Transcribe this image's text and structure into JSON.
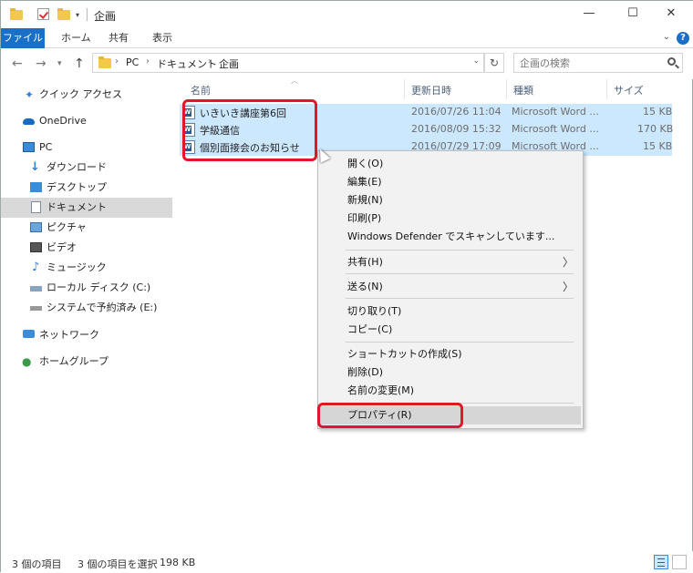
{
  "window": {
    "title": "企画",
    "controls": {
      "minimize": "—",
      "maximize": "☐",
      "close": "✕"
    }
  },
  "ribbon": {
    "tabs": [
      "ファイル",
      "ホーム",
      "共有",
      "表示"
    ],
    "help": "?"
  },
  "address": {
    "crumbs": [
      "PC",
      "ドキュメント",
      "企画"
    ],
    "separator": "›",
    "search_placeholder": "企画の検索"
  },
  "nav": {
    "items": [
      {
        "label": "クイック アクセス",
        "icon": "star-icon"
      },
      {
        "label": "OneDrive",
        "icon": "cloud-icon"
      },
      {
        "label": "PC",
        "icon": "pc-icon"
      },
      {
        "label": "ダウンロード",
        "icon": "download-icon"
      },
      {
        "label": "デスクトップ",
        "icon": "desktop-icon"
      },
      {
        "label": "ドキュメント",
        "icon": "documents-icon"
      },
      {
        "label": "ピクチャ",
        "icon": "pictures-icon"
      },
      {
        "label": "ビデオ",
        "icon": "videos-icon"
      },
      {
        "label": "ミュージック",
        "icon": "music-icon"
      },
      {
        "label": "ローカル ディスク (C:)",
        "icon": "drive-icon"
      },
      {
        "label": "システムで予約済み (E:)",
        "icon": "drive-icon"
      },
      {
        "label": "ネットワーク",
        "icon": "network-icon"
      },
      {
        "label": "ホームグループ",
        "icon": "homegroup-icon"
      }
    ]
  },
  "filelist": {
    "columns": [
      "名前",
      "更新日時",
      "種類",
      "サイズ"
    ],
    "rows": [
      {
        "name": "いきいき講座第6回",
        "date": "2016/07/26 11:04",
        "type": "Microsoft Word ...",
        "size": "15 KB"
      },
      {
        "name": "学級通信",
        "date": "2016/08/09 15:32",
        "type": "Microsoft Word ...",
        "size": "170 KB"
      },
      {
        "name": "個別面接会のお知らせ",
        "date": "2016/07/29 17:09",
        "type": "Microsoft Word ...",
        "size": "15 KB"
      }
    ]
  },
  "context_menu": {
    "items": [
      "開く(O)",
      "編集(E)",
      "新規(N)",
      "印刷(P)",
      "Windows Defender でスキャンしています...",
      "共有(H)",
      "送る(N)",
      "切り取り(T)",
      "コピー(C)",
      "ショートカットの作成(S)",
      "削除(D)",
      "名前の変更(M)",
      "プロパティ(R)"
    ],
    "submenu_arrow": "〉"
  },
  "status": {
    "item_count": "3 個の項目",
    "selection": "3 個の項目を選択",
    "selection_size": "198 KB"
  },
  "colors": {
    "accent": "#1a6fc6",
    "selection": "#cce8ff",
    "highlight": "#e0162b"
  }
}
